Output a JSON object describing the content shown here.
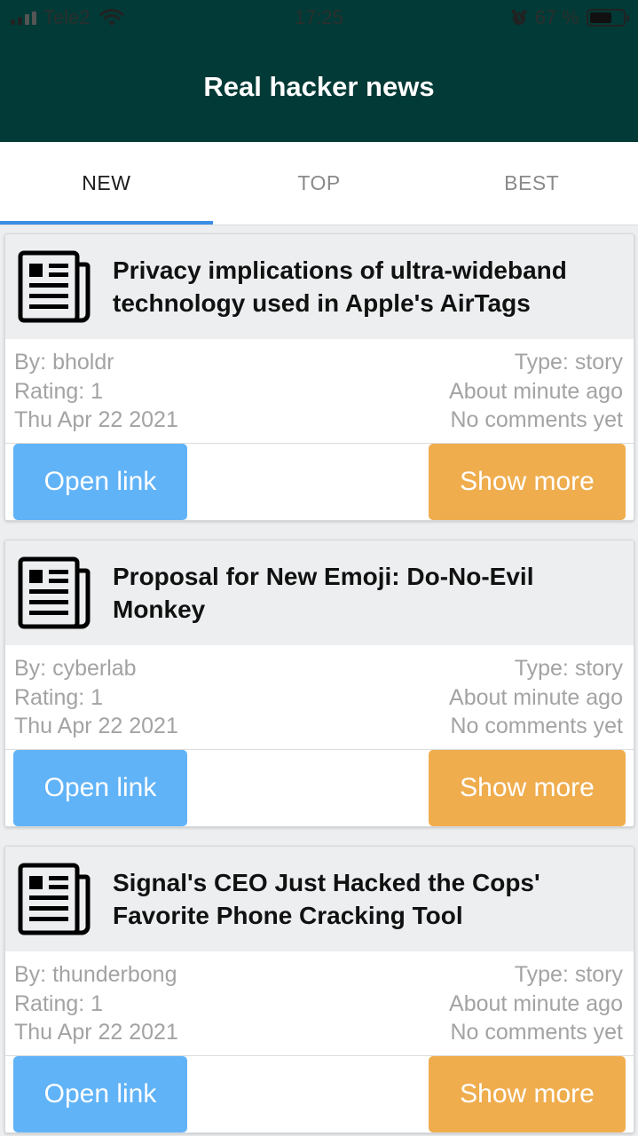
{
  "status_bar": {
    "carrier": "Tele2",
    "time": "17:25",
    "battery": "67 %",
    "battery_level": 0.67
  },
  "app": {
    "title": "Real hacker news"
  },
  "tabs": [
    {
      "label": "NEW",
      "active": true
    },
    {
      "label": "TOP",
      "active": false
    },
    {
      "label": "BEST",
      "active": false
    }
  ],
  "colors": {
    "header_bg": "#013a36",
    "tab_indicator": "#3a8ee6",
    "open_button": "#61b3f7",
    "more_button": "#efad4e"
  },
  "stories": [
    {
      "icon": "newspaper-icon",
      "title": "Privacy implications of ultra-wideband technology used in Apple's AirTags",
      "by": "By: bholdr",
      "rating": "Rating: 1",
      "date": "Thu Apr 22 2021",
      "type": "Type: story",
      "time": "About minute ago",
      "comments": "No comments yet",
      "open_label": "Open link",
      "more_label": "Show more"
    },
    {
      "icon": "newspaper-icon",
      "title": "Proposal for New Emoji: Do-No-Evil Monkey",
      "by": "By: cyberlab",
      "rating": "Rating: 1",
      "date": "Thu Apr 22 2021",
      "type": "Type: story",
      "time": "About minute ago",
      "comments": "No comments yet",
      "open_label": "Open link",
      "more_label": "Show more"
    },
    {
      "icon": "newspaper-icon",
      "title": "Signal's CEO Just Hacked the Cops' Favorite Phone Cracking Tool",
      "by": "By: thunderbong",
      "rating": "Rating: 1",
      "date": "Thu Apr 22 2021",
      "type": "Type: story",
      "time": "About minute ago",
      "comments": "No comments yet",
      "open_label": "Open link",
      "more_label": "Show more"
    }
  ]
}
